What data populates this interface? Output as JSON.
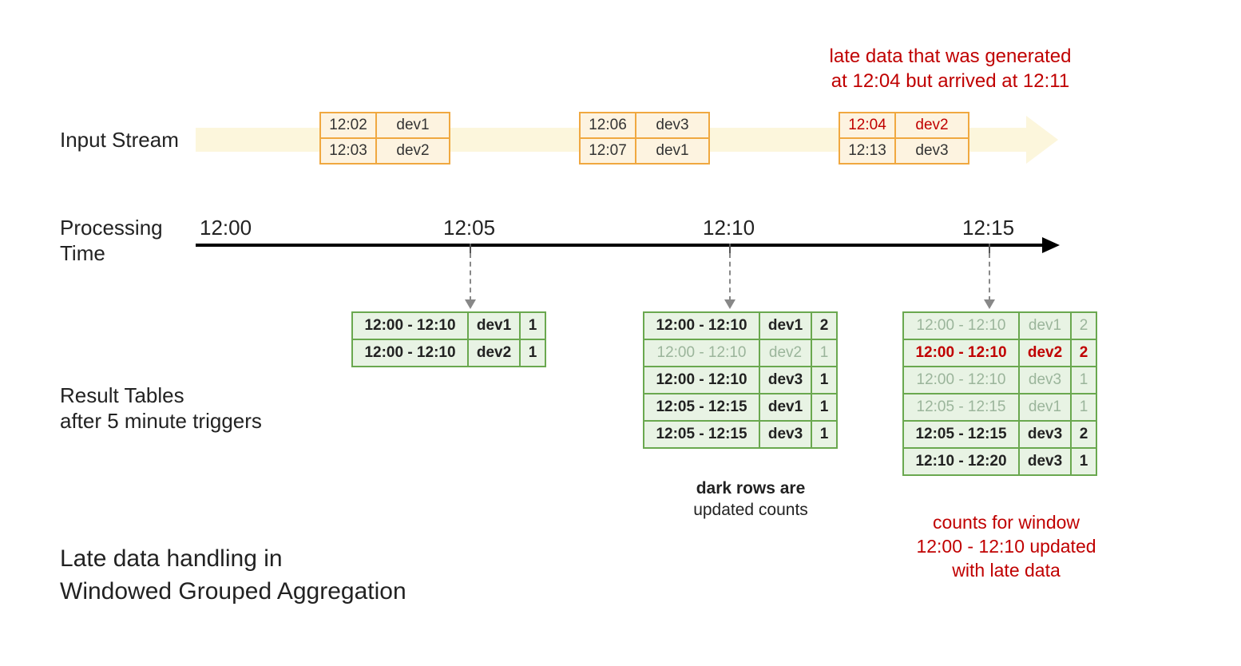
{
  "labels": {
    "input_stream": "Input Stream",
    "processing_time_l1": "Processing",
    "processing_time_l2": "Time",
    "result_tables_l1": "Result Tables",
    "result_tables_l2": "after 5 minute triggers",
    "title_l1": "Late data handling in",
    "title_l2": "Windowed Grouped Aggregation"
  },
  "late_note_l1": "late data that was generated",
  "late_note_l2": "at 12:04 but arrived at 12:11",
  "ticks": {
    "t0": "12:00",
    "t1": "12:05",
    "t2": "12:10",
    "t3": "12:15"
  },
  "stream": {
    "g1": {
      "r1_time": "12:02",
      "r1_dev": "dev1",
      "r2_time": "12:03",
      "r2_dev": "dev2"
    },
    "g2": {
      "r1_time": "12:06",
      "r1_dev": "dev3",
      "r2_time": "12:07",
      "r2_dev": "dev1"
    },
    "g3": {
      "r1_time": "12:04",
      "r1_dev": "dev2",
      "r2_time": "12:13",
      "r2_dev": "dev3"
    }
  },
  "tables": {
    "t1": [
      {
        "win": "12:00 - 12:10",
        "dev": "dev1",
        "cnt": "1"
      },
      {
        "win": "12:00 - 12:10",
        "dev": "dev2",
        "cnt": "1"
      }
    ],
    "t2": [
      {
        "win": "12:00 - 12:10",
        "dev": "dev1",
        "cnt": "2"
      },
      {
        "win": "12:00 - 12:10",
        "dev": "dev2",
        "cnt": "1"
      },
      {
        "win": "12:00 - 12:10",
        "dev": "dev3",
        "cnt": "1"
      },
      {
        "win": "12:05 - 12:15",
        "dev": "dev1",
        "cnt": "1"
      },
      {
        "win": "12:05 - 12:15",
        "dev": "dev3",
        "cnt": "1"
      }
    ],
    "t3": [
      {
        "win": "12:00 - 12:10",
        "dev": "dev1",
        "cnt": "2"
      },
      {
        "win": "12:00 - 12:10",
        "dev": "dev2",
        "cnt": "2"
      },
      {
        "win": "12:00 - 12:10",
        "dev": "dev3",
        "cnt": "1"
      },
      {
        "win": "12:05 - 12:15",
        "dev": "dev1",
        "cnt": "1"
      },
      {
        "win": "12:05 - 12:15",
        "dev": "dev3",
        "cnt": "2"
      },
      {
        "win": "12:10 - 12:20",
        "dev": "dev3",
        "cnt": "1"
      }
    ]
  },
  "captions": {
    "dark_rows_l1": "dark rows are",
    "dark_rows_l2": "updated counts",
    "late_upd_l1": "counts for window",
    "late_upd_l2": "12:00 - 12:10 updated",
    "late_upd_l3": "with late data"
  },
  "chart_data": {
    "type": "table",
    "description": "Diagram showing late data handling in windowed grouped aggregation with 5-minute processing triggers over 10-minute overlapping windows sliding every 5 minutes.",
    "processing_time_ticks": [
      "12:00",
      "12:05",
      "12:10",
      "12:15"
    ],
    "input_stream_events": [
      {
        "event_time": "12:02",
        "device": "dev1",
        "arrival_bucket": "12:00-12:05"
      },
      {
        "event_time": "12:03",
        "device": "dev2",
        "arrival_bucket": "12:00-12:05"
      },
      {
        "event_time": "12:06",
        "device": "dev3",
        "arrival_bucket": "12:05-12:10"
      },
      {
        "event_time": "12:07",
        "device": "dev1",
        "arrival_bucket": "12:05-12:10"
      },
      {
        "event_time": "12:04",
        "device": "dev2",
        "arrival_bucket": "12:10-12:15",
        "late": true,
        "arrived_at": "12:11"
      },
      {
        "event_time": "12:13",
        "device": "dev3",
        "arrival_bucket": "12:10-12:15"
      }
    ],
    "result_snapshots": [
      {
        "trigger": "12:05",
        "rows": [
          {
            "window": "12:00 - 12:10",
            "device": "dev1",
            "count": 1,
            "updated": true
          },
          {
            "window": "12:00 - 12:10",
            "device": "dev2",
            "count": 1,
            "updated": true
          }
        ]
      },
      {
        "trigger": "12:10",
        "rows": [
          {
            "window": "12:00 - 12:10",
            "device": "dev1",
            "count": 2,
            "updated": true
          },
          {
            "window": "12:00 - 12:10",
            "device": "dev2",
            "count": 1,
            "updated": false
          },
          {
            "window": "12:00 - 12:10",
            "device": "dev3",
            "count": 1,
            "updated": true
          },
          {
            "window": "12:05 - 12:15",
            "device": "dev1",
            "count": 1,
            "updated": true
          },
          {
            "window": "12:05 - 12:15",
            "device": "dev3",
            "count": 1,
            "updated": true
          }
        ]
      },
      {
        "trigger": "12:15",
        "rows": [
          {
            "window": "12:00 - 12:10",
            "device": "dev1",
            "count": 2,
            "updated": false
          },
          {
            "window": "12:00 - 12:10",
            "device": "dev2",
            "count": 2,
            "updated": true,
            "late_update": true
          },
          {
            "window": "12:00 - 12:10",
            "device": "dev3",
            "count": 1,
            "updated": false
          },
          {
            "window": "12:05 - 12:15",
            "device": "dev1",
            "count": 1,
            "updated": false
          },
          {
            "window": "12:05 - 12:15",
            "device": "dev3",
            "count": 2,
            "updated": true
          },
          {
            "window": "12:10 - 12:20",
            "device": "dev3",
            "count": 1,
            "updated": true
          }
        ]
      }
    ]
  }
}
